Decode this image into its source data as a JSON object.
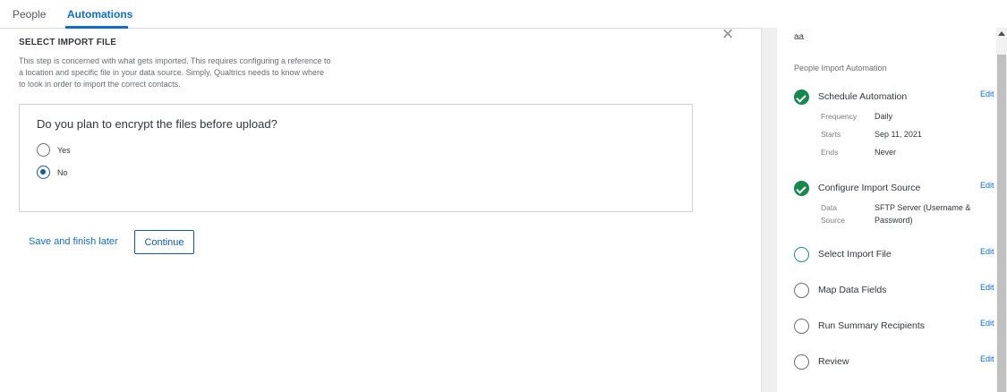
{
  "tabs": [
    {
      "label": "People"
    },
    {
      "label": "Automations"
    }
  ],
  "main": {
    "close_glyph": "×",
    "section_title": "SELECT IMPORT FILE",
    "section_desc_lines": [
      "This step is concerned with what gets imported. This requires configuring a reference to",
      "a location and specific file in your data source. Simply, Qualtrics needs to know where",
      "to look in order to import the correct contacts."
    ],
    "question": "Do you plan to encrypt the files before upload?",
    "options": [
      {
        "label": "Yes",
        "selected": false
      },
      {
        "label": "No",
        "selected": true
      }
    ],
    "save_later": "Save and finish later",
    "continue": "Continue"
  },
  "panel": {
    "top_text": "aa",
    "title": "People Import Automation",
    "edit_label": "Edit",
    "steps": [
      {
        "label": "Schedule Automation",
        "status": "done",
        "details": [
          {
            "key": "Frequency",
            "value": "Daily"
          },
          {
            "key": "Starts",
            "value": "Sep 11, 2021"
          },
          {
            "key": "Ends",
            "value": "Never"
          }
        ]
      },
      {
        "label": "Configure Import Source",
        "status": "done",
        "details": [
          {
            "key": "Data Source",
            "value": "SFTP Server (Username & Password)"
          }
        ]
      },
      {
        "label": "Select Import File",
        "status": "current"
      },
      {
        "label": "Map Data Fields",
        "status": "pending"
      },
      {
        "label": "Run Summary Recipients",
        "status": "pending"
      },
      {
        "label": "Review",
        "status": "pending"
      }
    ]
  },
  "colors": {
    "accent": "#0b6ed0",
    "success": "#138a4b",
    "current_step": "#1a8b9e"
  }
}
